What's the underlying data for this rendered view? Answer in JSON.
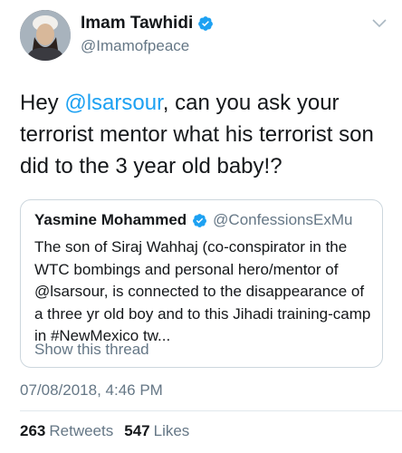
{
  "author": {
    "name": "Imam Tawhidi",
    "handle": "@Imamofpeace"
  },
  "tweet": {
    "text_before": "Hey ",
    "mention": "@lsarsour",
    "text_after": ", can you ask your terrorist mentor what his terrorist son did to the 3 year old baby!?"
  },
  "quote": {
    "name": "Yasmine Mohammed",
    "handle": "@ConfessionsExMu",
    "text": "The son of Siraj Wahhaj (co-conspirator in the WTC bombings and personal hero/mentor of @lsarsour, is connected to the disappearance of a three yr old boy and to this Jihadi training-camp in #NewMexico tw...",
    "show_thread": "Show this thread"
  },
  "timestamp": "07/08/2018, 4:46 PM",
  "stats": {
    "retweets_count": "263",
    "retweets_label": "Retweets",
    "likes_count": "547",
    "likes_label": "Likes"
  },
  "colors": {
    "accent": "#1da1f2",
    "secondary_text": "#657786",
    "border": "#ccd6dd"
  },
  "icons": [
    "verified-badge-icon",
    "chevron-down-icon"
  ]
}
